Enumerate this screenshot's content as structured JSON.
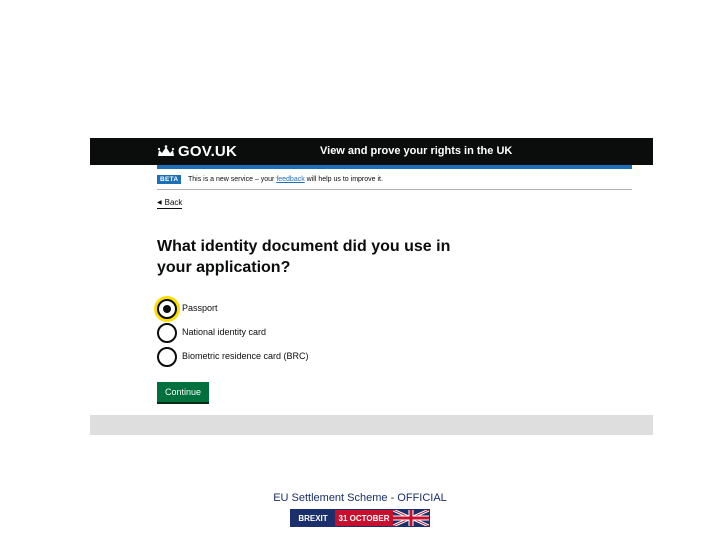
{
  "header": {
    "logo_text": "GOV.UK",
    "service_name": "View and prove your rights in the UK"
  },
  "phase_banner": {
    "tag": "BETA",
    "text_before": "This is a new service – your ",
    "link_text": "feedback",
    "text_after": " will help us to improve it."
  },
  "back_link": {
    "label": "Back"
  },
  "question": {
    "text": "What identity document did you use in your application?"
  },
  "options": [
    {
      "label": "Passport",
      "selected": true
    },
    {
      "label": "National identity card",
      "selected": false
    },
    {
      "label": "Biometric residence card (BRC)",
      "selected": false
    }
  ],
  "continue_button": {
    "label": "Continue"
  },
  "slide_footer": {
    "classification": "EU Settlement Scheme - OFFICIAL",
    "badge_part1": "BREXIT",
    "badge_part2": "31 OCTOBER"
  },
  "colors": {
    "header_bg": "#0b0c0c",
    "accent_blue": "#1d70b8",
    "button_green": "#00703c",
    "focus_yellow": "#ffdd00"
  }
}
